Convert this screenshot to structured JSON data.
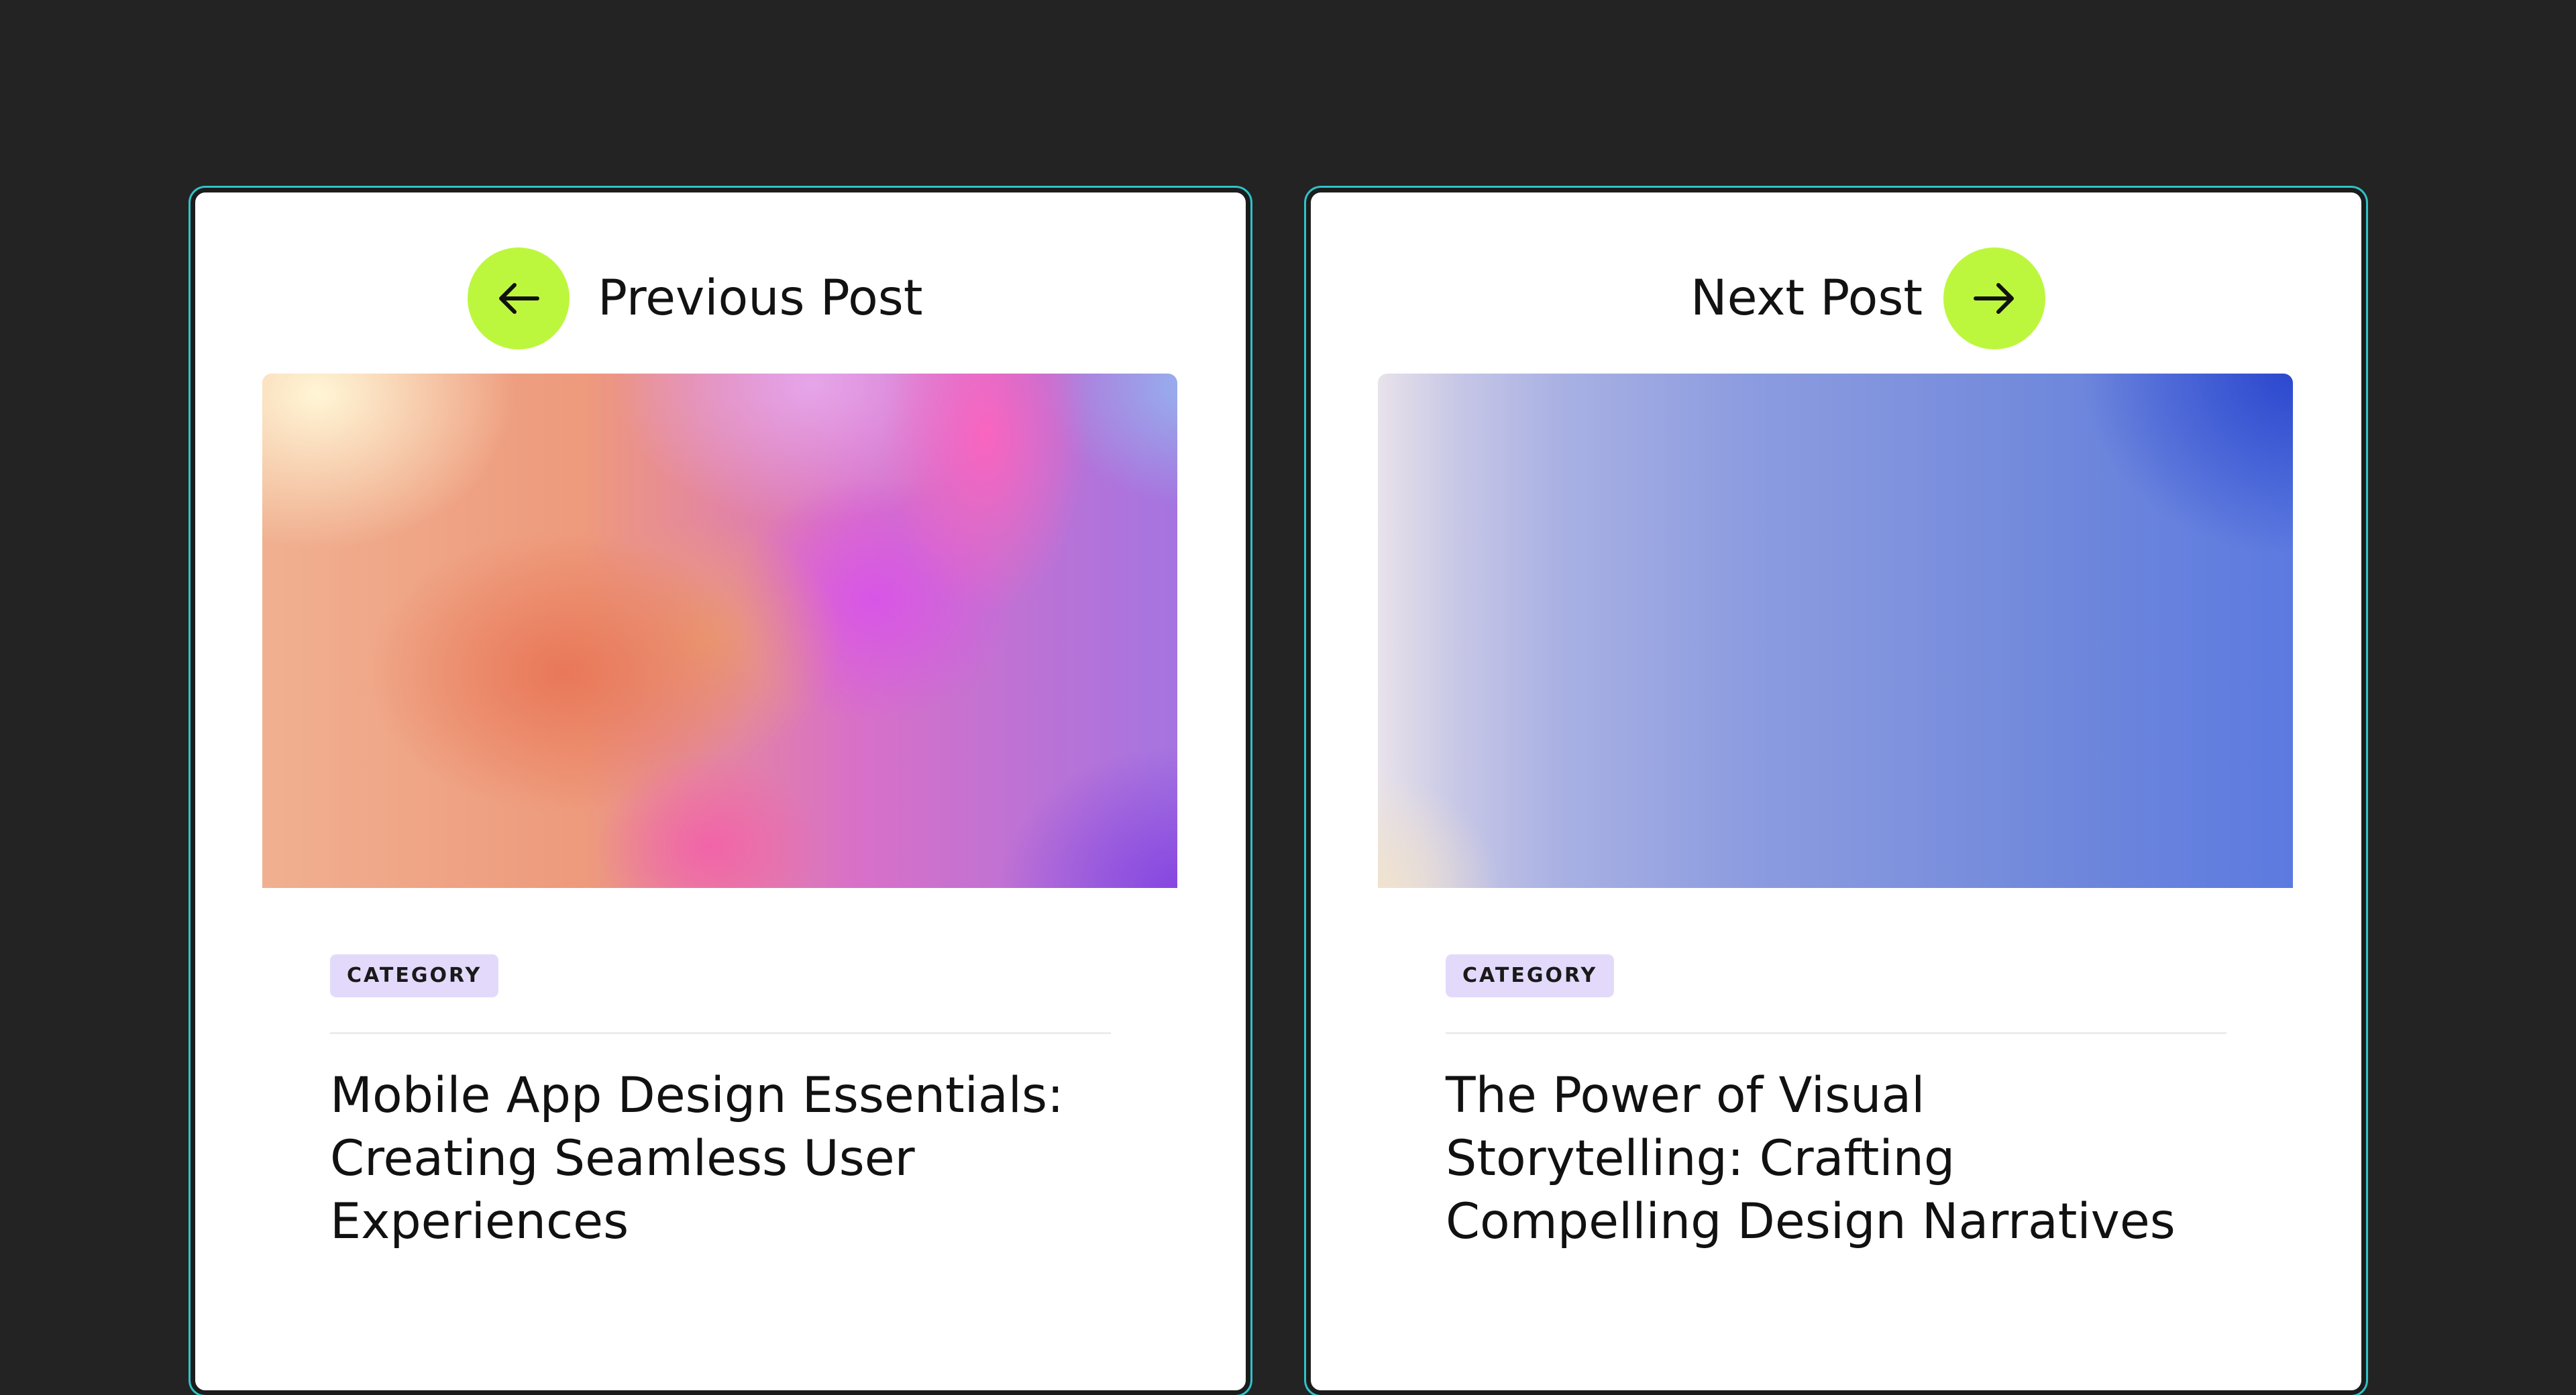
{
  "colors": {
    "page_background": "#232323",
    "card_background": "#ffffff",
    "card_outline": "#2fc3c8",
    "nav_button": "#bdf73d",
    "badge_background": "#e3dafb",
    "text": "#111111"
  },
  "previous": {
    "nav_label": "Previous Post",
    "nav_icon": "arrow-left-icon",
    "category": "CATEGORY",
    "title": "Mobile App Design Essentials: Creating Seamless User Experiences"
  },
  "next": {
    "nav_label": "Next Post",
    "nav_icon": "arrow-right-icon",
    "category": "CATEGORY",
    "title": "The Power of Visual Storytelling: Crafting Compelling Design Narratives"
  }
}
